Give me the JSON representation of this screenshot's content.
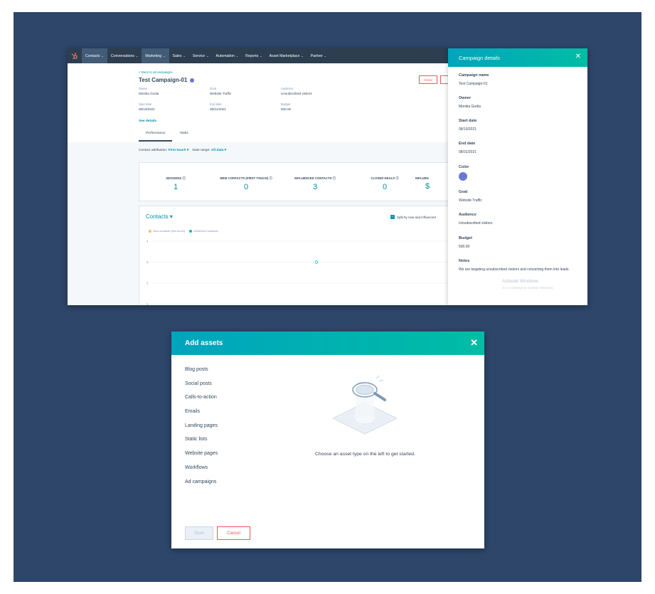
{
  "nav": {
    "items": [
      {
        "label": "Contacts"
      },
      {
        "label": "Conversations"
      },
      {
        "label": "Marketing"
      },
      {
        "label": "Sales"
      },
      {
        "label": "Service"
      },
      {
        "label": "Automation"
      },
      {
        "label": "Reports"
      },
      {
        "label": "Asset Marketplace"
      },
      {
        "label": "Partner"
      }
    ]
  },
  "campaign": {
    "back_link": "< Back to all campaigns",
    "title": "Test Campaign-01",
    "owner_label": "Owner",
    "owner": "Monika Godia",
    "goal_label": "Goal",
    "goal": "Website Traffic",
    "audience_label": "Audience",
    "audience": "Unsubscribed visitors",
    "start_label": "Start date",
    "start": "08/19/2021",
    "end_label": "End date",
    "end": "08/31/2021",
    "budget_label": "Budget",
    "budget": "500.00",
    "see_details": "See details",
    "close_btn": "Clone",
    "tabs": [
      "Performance",
      "Tasks"
    ]
  },
  "filters": {
    "attribution_label": "Contact attribution:",
    "attribution_value": "First touch",
    "range_label": "Date range:",
    "range_value": "All data"
  },
  "kpis": [
    {
      "label": "SESSIONS",
      "value": "1"
    },
    {
      "label": "NEW CONTACTS (FIRST TOUCH)",
      "value": "0"
    },
    {
      "label": "INFLUENCED CONTACTS",
      "value": "3"
    },
    {
      "label": "CLOSED DEALS",
      "value": "0"
    },
    {
      "label": "INFLUEN",
      "value": "$"
    }
  ],
  "contacts_chart": {
    "title": "Contacts",
    "split_label": "Split by new and influenced",
    "legend": [
      "New contacts (first touch)",
      "Influenced contacts"
    ],
    "colors": {
      "new": "#f5c26b",
      "influenced": "#00bda5"
    }
  },
  "chart_data": {
    "type": "line",
    "title": "Contacts",
    "yticks": [
      "4",
      "3",
      "2",
      "1"
    ],
    "series": [
      {
        "name": "New contacts (first touch)",
        "values": []
      },
      {
        "name": "Influenced contacts",
        "values": [
          3
        ]
      }
    ]
  },
  "drawer": {
    "title": "Campaign details",
    "fields": [
      {
        "label": "Campaign name",
        "value": "Test Campaign-01"
      },
      {
        "label": "Owner",
        "value": "Monika Godia"
      },
      {
        "label": "Start date",
        "value": "08/19/2021"
      },
      {
        "label": "End date",
        "value": "08/31/2021"
      },
      {
        "label": "Color",
        "value": ""
      },
      {
        "label": "Goal",
        "value": "Website Traffic"
      },
      {
        "label": "Audience",
        "value": "Unsubscribed visitors"
      },
      {
        "label": "Budget",
        "value": "500.00"
      },
      {
        "label": "Notes",
        "value": "We are targeting unsubscribed visitors and converting them into leads."
      }
    ],
    "color": "#6a78d1"
  },
  "watermark": {
    "line1": "Activate Windows",
    "line2": "Go to Settings to activate Windows."
  },
  "modal": {
    "title": "Add assets",
    "assets": [
      "Blog posts",
      "Social posts",
      "Calls-to-action",
      "Emails",
      "Landing pages",
      "Static lists",
      "Website pages",
      "Workflows",
      "Ad campaigns"
    ],
    "empty_text": "Choose an asset type on the left to get started.",
    "save": "Save",
    "cancel": "Cancel"
  },
  "colors": {
    "background": "#2d4669",
    "nav": "#2d3e50",
    "accent": "#00a4bd",
    "link": "#0091ae",
    "danger": "#f2545b"
  }
}
